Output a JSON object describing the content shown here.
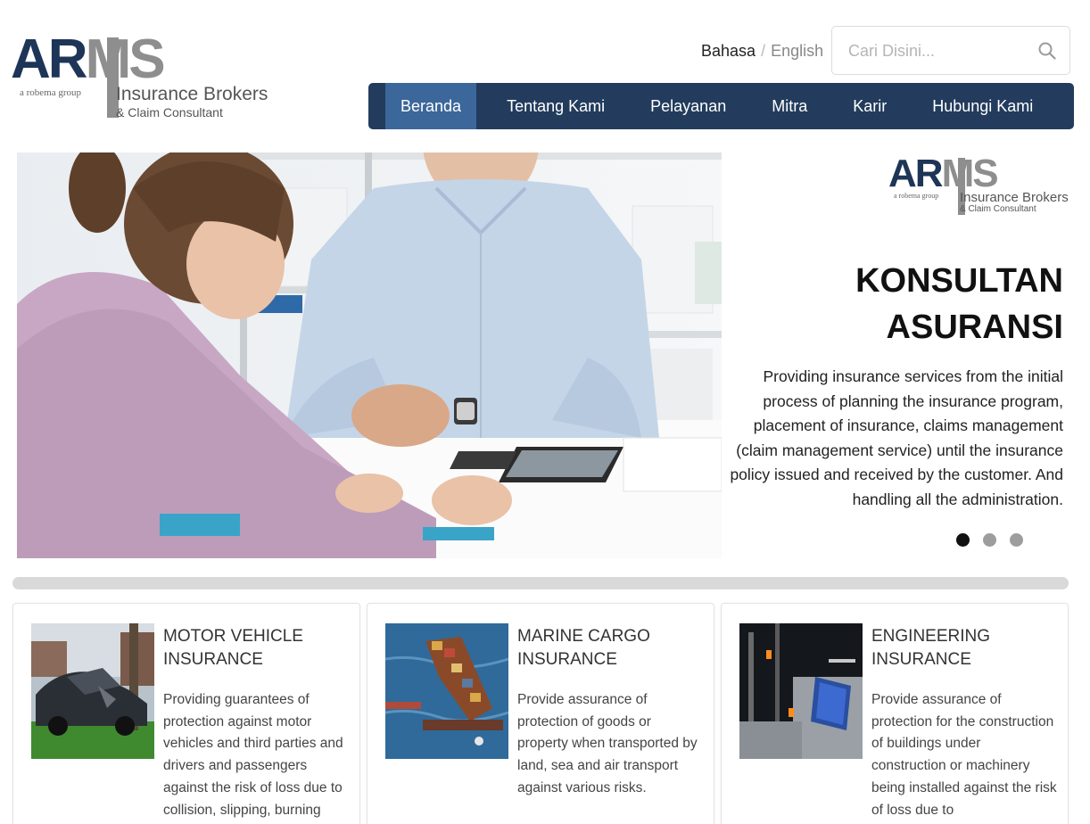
{
  "header": {
    "logo": {
      "brand_ar": "AR",
      "brand_ms": "MS",
      "group": "a robema group",
      "line1": "Insurance Brokers",
      "line2": "& Claim Consultant"
    },
    "lang": {
      "label": "Bahasa",
      "separator": "/",
      "option": "English"
    },
    "search": {
      "placeholder": "Cari Disini..."
    },
    "nav": [
      {
        "label": "Beranda",
        "active": true
      },
      {
        "label": "Tentang Kami"
      },
      {
        "label": "Pelayanan"
      },
      {
        "label": "Mitra"
      },
      {
        "label": "Karir"
      },
      {
        "label": "Hubungi Kami"
      }
    ]
  },
  "hero": {
    "title_line1": "KONSULTAN",
    "title_line2": "ASURANSI",
    "description": "Providing insurance services from the initial process of planning the insurance program, placement of insurance, claims management (claim management service) until the insurance policy issued and received by the customer. And handling all the administration.",
    "slides_total": 3,
    "active_slide": 1
  },
  "services": [
    {
      "title": "MOTOR VEHICLE INSURANCE",
      "description": "Providing guarantees of protection against motor vehicles and third parties and drivers and passengers against the risk of loss due to collision, slipping, burning",
      "image": "crashed-car-photo"
    },
    {
      "title": "MARINE CARGO INSURANCE",
      "description": "Provide assurance of protection of goods or property when transported by land, sea and air transport against various risks.",
      "image": "cargo-ship-photo"
    },
    {
      "title": "ENGINEERING INSURANCE",
      "description": "Provide assurance of protection for the construction of buildings under construction or machinery being installed against the risk of loss due to",
      "image": "construction-site-photo"
    }
  ],
  "colors": {
    "navy": "#233c5d",
    "nav_active": "#3b679a",
    "brand_grey": "#8e8e8e"
  }
}
